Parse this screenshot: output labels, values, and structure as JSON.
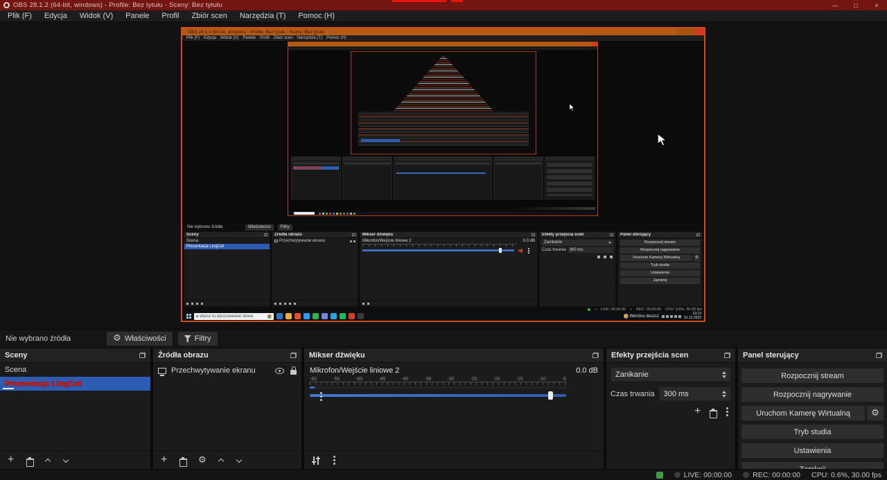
{
  "titlebar": {
    "title": "OBS 28.1.2 (64-bit, windows) - Profile: Bez tytułu - Sceny: Bez tytułu",
    "controls": {
      "minimize": "—",
      "maximize": "□",
      "close": "×"
    }
  },
  "menu": {
    "items": [
      "Plik (F)",
      "Edycja",
      "Widok (V)",
      "Panele",
      "Profil",
      "Zbiór scen",
      "Narzędzia (T)",
      "Pomoc (H)"
    ]
  },
  "source_toolbar": {
    "no_source_label": "Nie wybrano źródła",
    "properties_label": "Właściwości",
    "filters_label": "Filtry"
  },
  "docks": {
    "scenes": {
      "title": "Sceny",
      "items": [
        "Scena",
        "Prezentacja LingCat"
      ],
      "selected_index": 1
    },
    "sources": {
      "title": "Źródła obrazu",
      "items": [
        "Przechwytywanie ekranu"
      ]
    },
    "mixer": {
      "title": "Mikser dźwięku",
      "channel_name": "Mikrofon/Wejście liniowe 2",
      "channel_level": "0.0 dB",
      "ticks": [
        "-60",
        "-55",
        "-50",
        "-45",
        "-40",
        "-35",
        "-30",
        "-25",
        "-20",
        "-15",
        "-10",
        "-5"
      ],
      "slider_percent": 93,
      "muted": true
    },
    "transitions": {
      "title": "Efekty przejścia scen",
      "transition_value": "Zanikanie",
      "duration_label": "Czas trwania",
      "duration_value": "300 ms"
    },
    "controls": {
      "title": "Panel sterujący",
      "buttons": [
        "Rozpocznij stream",
        "Rozpocznij nagrywanie",
        "Uruchom Kamerę Wirtualną",
        "Tryb studia",
        "Ustawienia",
        "Zamknij"
      ]
    }
  },
  "statusbar": {
    "live": "LIVE: 00:00:00",
    "rec": "REC: 00:00:00",
    "cpu": "CPU: 0.6%, 30.00 fps"
  },
  "preview": {
    "taskbar": {
      "search_placeholder": "Wpisz tu wyszukiwane słowa",
      "weather_label": "Wkrótce deszcz",
      "clock_time": "13:13",
      "clock_date": "31.12.2022",
      "app_colors": [
        "#2e75c8",
        "#e8b339",
        "#e2512b",
        "#2a9df4",
        "#36b24a",
        "#7289da",
        "#29a8dd",
        "#1db954",
        "#d23f31",
        "#3a3a3a"
      ]
    },
    "colors": {
      "selection_border": "#cf4e17",
      "captured_titlebar": "#b45a14"
    }
  },
  "colors": {
    "health_green": "#3f9c46",
    "mute_red": "#d03a28",
    "accent_blue": "#2d5cb5",
    "titlebar_maroon": "#751511"
  }
}
